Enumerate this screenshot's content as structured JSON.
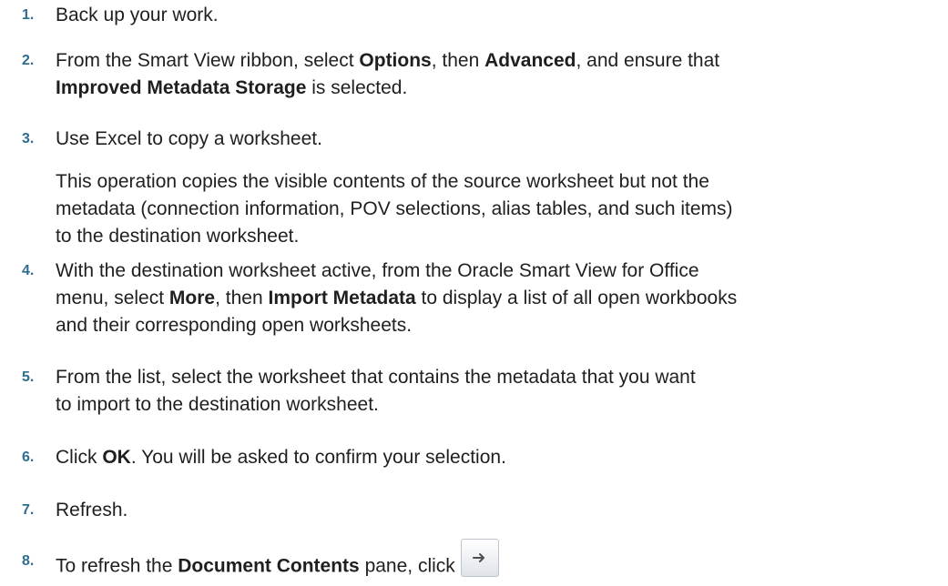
{
  "steps": [
    {
      "num": "1.",
      "text": "Back up your work."
    },
    {
      "num": "2.",
      "t1": "From the Smart View ribbon, select ",
      "b1": "Options",
      "t2": ", then ",
      "b2": "Advanced",
      "t3": ", and ensure that",
      "b3": "Improved Metadata Storage",
      "t4": " is selected."
    },
    {
      "num": "3.",
      "text": "Use Excel to copy a worksheet.",
      "note": "This operation copies the visible contents of the source worksheet but not the metadata (connection information, POV selections, alias tables, and such items) to the destination worksheet."
    },
    {
      "num": "4.",
      "t1": "With the destination worksheet active, from the Oracle Smart View for Office menu, select ",
      "b1": "More",
      "t2": ", then ",
      "b2": "Import Metadata",
      "t3": " to display a list of all open workbooks and their corresponding open worksheets."
    },
    {
      "num": "5.",
      "text": "From the list, select the worksheet that contains the metadata that you want to import to the destination worksheet."
    },
    {
      "num": "6.",
      "t1": "Click ",
      "b1": "OK",
      "t2": ". You will be asked to confirm your selection."
    },
    {
      "num": "7.",
      "text": "Refresh."
    },
    {
      "num": "8.",
      "t1": "To refresh the ",
      "b1": "Document Contents",
      "t2": " pane, click",
      "button_icon": "arrow-right-icon"
    }
  ]
}
